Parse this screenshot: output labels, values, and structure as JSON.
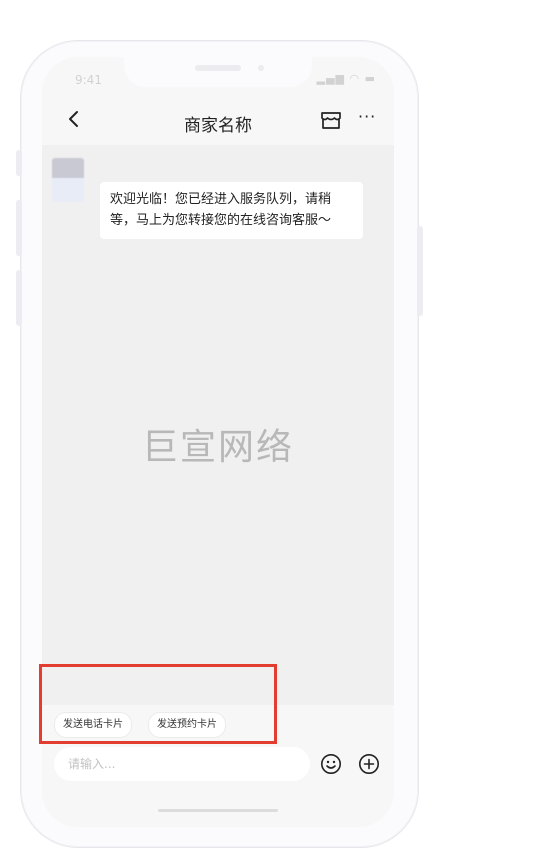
{
  "status_bar": {
    "time": "9:41",
    "indicators": "▂▄▆ ◠ ▬"
  },
  "nav": {
    "title": "商家名称",
    "back_icon": "chevron-left-icon",
    "shop_icon": "store-icon",
    "more_label": "···"
  },
  "chat": {
    "messages": [
      {
        "from": "merchant",
        "text": "欢迎光临！您已经进入服务队列，请稍等，马上为您转接您的在线咨询客服～"
      }
    ],
    "watermark": "巨宣网络"
  },
  "quick_cards": [
    "发送电话卡片",
    "发送预约卡片"
  ],
  "input": {
    "placeholder": "请输入...",
    "value": ""
  },
  "icons": {
    "emoji": "smiley-icon",
    "plus": "plus-circle-icon"
  },
  "colors": {
    "highlight": "#e23d2e",
    "chat_bg": "#f0f0f0",
    "bubble_bg": "#ffffff"
  }
}
